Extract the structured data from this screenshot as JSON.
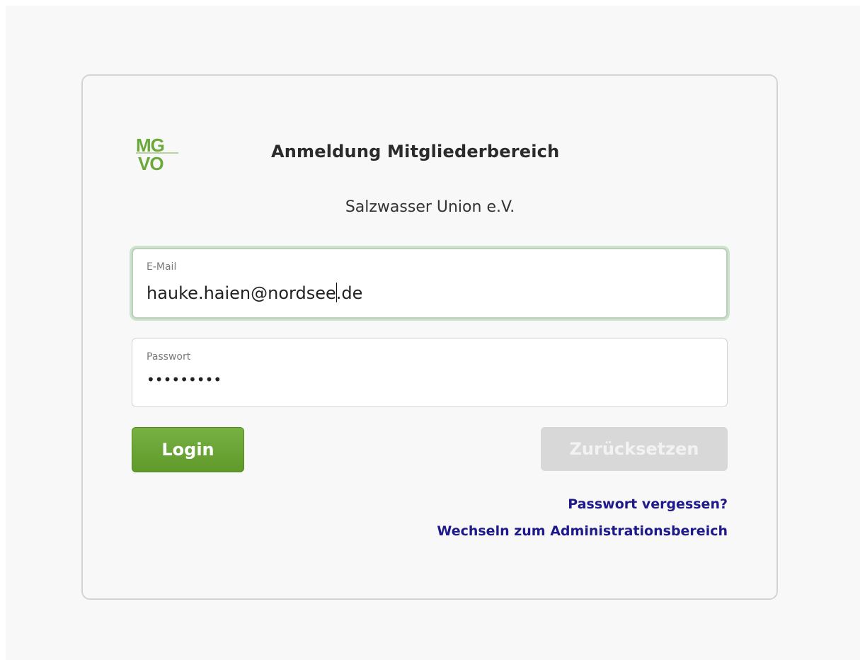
{
  "app": {
    "title": "Anmeldung Mitgliederbereich",
    "organization": "Salzwasser Union e.V.",
    "logo": {
      "text_top": "MG",
      "text_bottom": "VO",
      "icon": "mgvo-logo",
      "color": "#6aa83a"
    }
  },
  "form": {
    "email": {
      "label": "E-Mail",
      "value_before_caret": "hauke.haien@nordsee",
      "value_after_caret": ".de"
    },
    "password": {
      "label": "Passwort",
      "masked_value": "•••••••••"
    },
    "buttons": {
      "login_label": "Login",
      "reset_label": "Zurücksetzen"
    },
    "links": {
      "forgot_password": "Passwort vergessen?",
      "switch_admin": "Wechseln zum Administrationsbereich"
    }
  },
  "colors": {
    "accent_green": "#6aa83a",
    "link_color": "#1f1a8c",
    "disabled_button": "#d8d8d8"
  }
}
